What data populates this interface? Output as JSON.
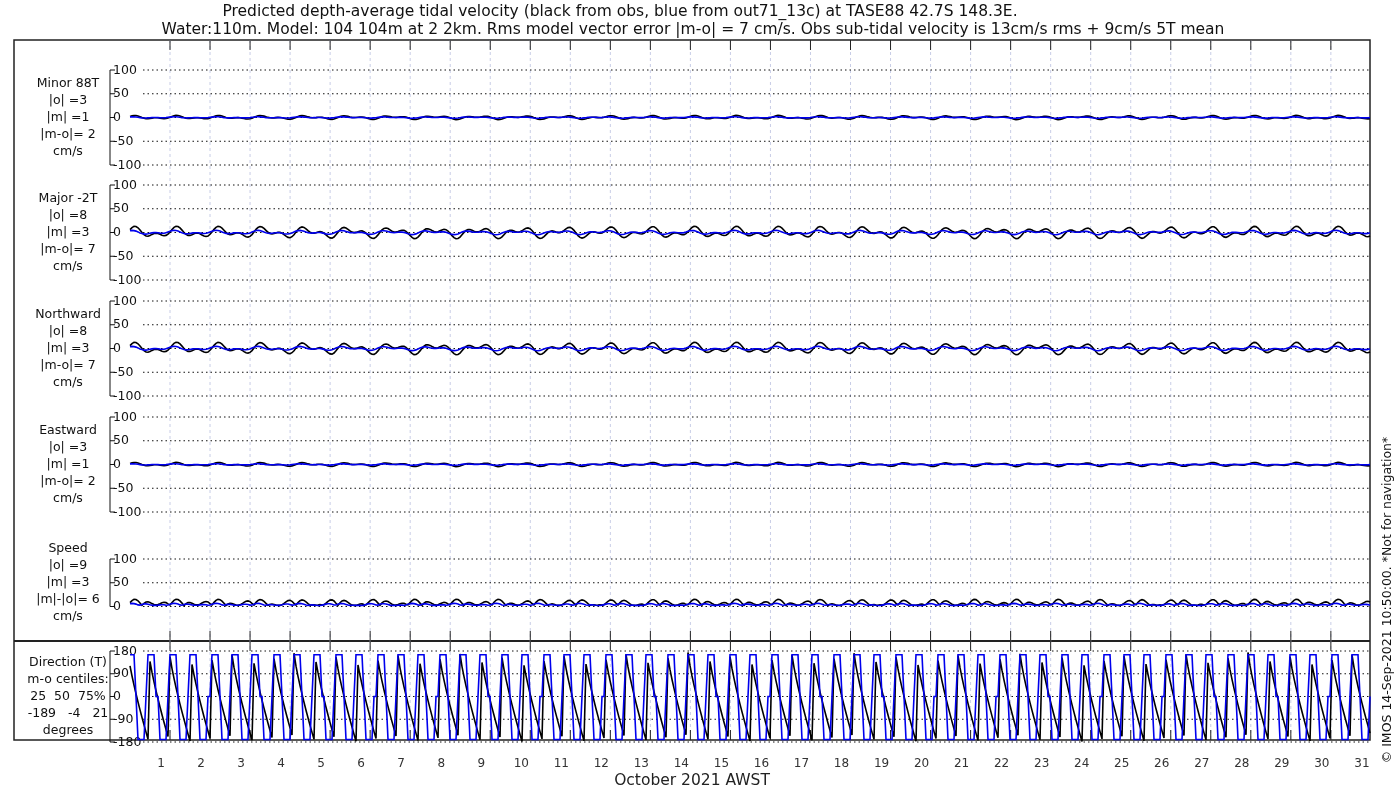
{
  "title_lines": [
    "Predicted depth-average tidal velocity (black from obs, blue from out71_13c) at TASE88 42.7S 148.3E.",
    "Water:110m. Model: 104 104m at 2 2km. Rms model vector error |m-o| = 7 cm/s. Obs sub-tidal velocity is 13cm/s rms + 9cm/s 5T mean"
  ],
  "panels": [
    {
      "kind": "velocity",
      "label_lines": [
        "Minor 88T",
        "|o| =3",
        "|m| =1",
        "|m-o|= 2",
        "cm/s"
      ],
      "yticks": [
        "100",
        "50",
        "0",
        "-50",
        "-100"
      ]
    },
    {
      "kind": "velocity",
      "label_lines": [
        "Major -2T",
        "|o| =8",
        "|m| =3",
        "|m-o|= 7",
        "cm/s"
      ],
      "yticks": [
        "100",
        "50",
        "0",
        "-50",
        "-100"
      ]
    },
    {
      "kind": "velocity",
      "label_lines": [
        "Northward",
        "|o| =8",
        "|m| =3",
        "|m-o|= 7",
        "cm/s"
      ],
      "yticks": [
        "100",
        "50",
        "0",
        "-50",
        "-100"
      ]
    },
    {
      "kind": "velocity",
      "label_lines": [
        "Eastward",
        "|o| =3",
        "|m| =1",
        "|m-o|= 2",
        "cm/s"
      ],
      "yticks": [
        "100",
        "50",
        "0",
        "-50",
        "-100"
      ]
    },
    {
      "kind": "speed",
      "label_lines": [
        "Speed",
        "|o| =9",
        "|m| =3",
        "|m|-|o|= 6",
        "cm/s"
      ],
      "yticks": [
        "100",
        "50",
        "0"
      ]
    },
    {
      "kind": "direction",
      "label_lines": [
        "Direction (T)",
        "m-o centiles:",
        "25  50  75%",
        "-189   -4   21",
        "degrees"
      ],
      "yticks": [
        "180",
        "90",
        "0",
        "-90",
        "-180"
      ]
    }
  ],
  "x_tick_labels": [
    "1",
    "2",
    "3",
    "4",
    "5",
    "6",
    "7",
    "8",
    "9",
    "10",
    "11",
    "12",
    "13",
    "14",
    "15",
    "16",
    "17",
    "18",
    "19",
    "20",
    "21",
    "22",
    "23",
    "24",
    "25",
    "26",
    "27",
    "28",
    "29",
    "30",
    "31"
  ],
  "xlabel": "October 2021 AWST",
  "footer": "© IMOS 14-Sep-2021 10:50:00. *Not for navigation*"
}
